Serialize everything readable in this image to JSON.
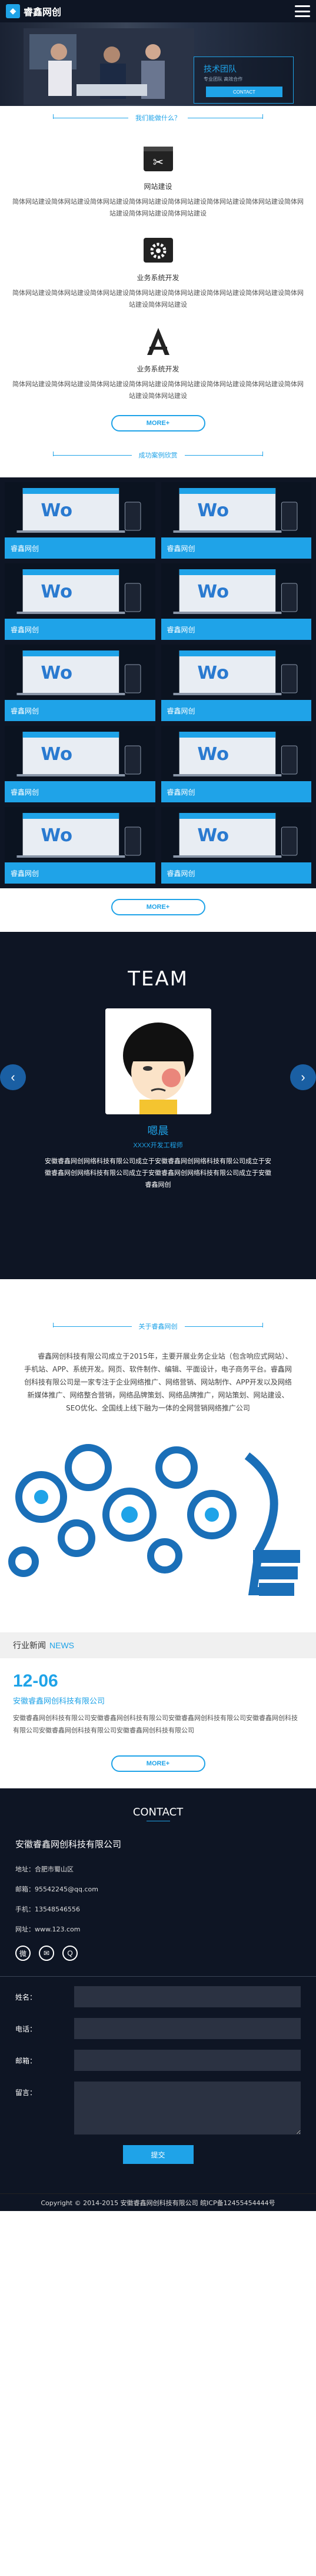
{
  "header": {
    "logo_text": "睿鑫网创"
  },
  "hero": {
    "title": "技术团队",
    "subtitle": "专业团队 高效合作",
    "button": "CONTACT"
  },
  "services": {
    "heading": "我们能做什么？",
    "items": [
      {
        "title": "网站建设",
        "text": "简体网站建设简体网站建设简体网站建设简体网站建设简体网站建设简体网站建设简体网站建设简体网站建设简体网站建设简体网站建设"
      },
      {
        "title": "业务系统开发",
        "text": "简体网站建设简体网站建设简体网站建设简体网站建设简体网站建设简体网站建设简体网站建设简体网站建设简体网站建设"
      },
      {
        "title": "业务系统开发",
        "text": "简体网站建设简体网站建设简体网站建设简体网站建设简体网站建设简体网站建设简体网站建设简体网站建设简体网站建设"
      }
    ],
    "more": "MORE+"
  },
  "cases": {
    "heading": "成功案例欣赏",
    "items": [
      "睿鑫网创",
      "睿鑫网创",
      "睿鑫网创",
      "睿鑫网创",
      "睿鑫网创",
      "睿鑫网创",
      "睿鑫网创",
      "睿鑫网创",
      "睿鑫网创",
      "睿鑫网创"
    ],
    "more": "MORE+"
  },
  "team": {
    "title": "TEAM",
    "member": {
      "name": "嗯晨",
      "role": "XXXX开发工程师",
      "desc": "安徽睿鑫网创网络科技有限公司成立于安徽睿鑫网创网络科技有限公司成立于安徽睿鑫网创网络科技有限公司成立于安徽睿鑫网创网络科技有限公司成立于安徽睿鑫网创"
    }
  },
  "about": {
    "heading": "关于睿鑫网创",
    "text": "睿鑫网创科技有限公司成立于2015年，主要开展业务企业站（包含响应式网站）、手机站、APP、系统开发。网页、软件制作、编辑、平面设计，电子商务平台。睿鑫网创科技有限公司是一家专注于企业网络推广、网络营销、网站制作、APP开发以及网络新媒体推广、网络整合营销，网络品牌策划、网络品牌推广，网站策划、网站建设、SEO优化、全国线上线下融为一体的全网营销网络推广公司"
  },
  "news": {
    "label_cn": "行业新闻",
    "label_en": "NEWS",
    "date": "12-06",
    "title": "安徽睿鑫网创科技有限公司",
    "body": "安徽睿鑫网创科技有限公司安徽睿鑫网创科技有限公司安徽睿鑫网创科技有限公司安徽睿鑫网创科技有限公司安徽睿鑫网创科技有限公司安徽睿鑫网创科技有限公司",
    "more": "MORE+"
  },
  "contact": {
    "title": "CONTACT",
    "company": "安徽睿鑫网创科技有限公司",
    "address": "地址：合肥市蜀山区",
    "email": "邮箱：95542245@qq.com",
    "phone": "手机：13548546556",
    "site": "网址：www.123.com",
    "form": {
      "name": "姓名：",
      "phone": "电话：",
      "email": "邮箱：",
      "message": "留言：",
      "submit": "提交"
    }
  },
  "footer": {
    "text": "Copyright © 2014-2015 安徽睿鑫网创科技有限公司 皖ICP备12455454444号"
  },
  "colors": {
    "accent": "#1fa3e8",
    "dark": "#0e1524"
  }
}
